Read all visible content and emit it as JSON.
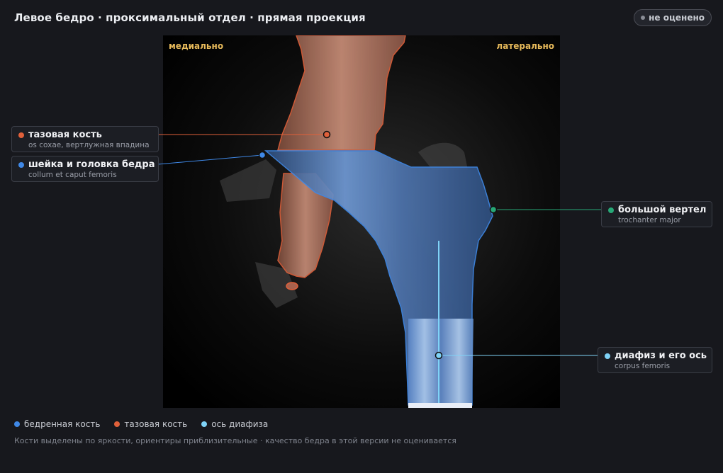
{
  "title": "Левое бедро · проксимальный отдел · прямая проекция",
  "status": {
    "label": "не оценено",
    "dot_color": "#8a8d96"
  },
  "viewer": {
    "orientation_left": "медиально",
    "orientation_right": "латерально"
  },
  "annotations": {
    "pelvis": {
      "title": "тазовая кость",
      "subtitle": "os coxae, вертлужная впадина",
      "color": "#e0603a"
    },
    "neck_head": {
      "title": "шейка и головка бедра",
      "subtitle": "collum et caput femoris",
      "color": "#3f88e6"
    },
    "greater_trochanter": {
      "title": "большой вертел",
      "subtitle": "trochanter major",
      "color": "#27a877"
    },
    "shaft": {
      "title": "диафиз и его ось",
      "subtitle": "corpus femoris",
      "color": "#7fd3f7"
    }
  },
  "legend": [
    {
      "label": "бедренная кость",
      "color": "#3f88e6"
    },
    {
      "label": "тазовая кость",
      "color": "#e0603a"
    },
    {
      "label": "ось диафиза",
      "color": "#7fd3f7"
    }
  ],
  "footnote": "Кости выделены по яркости, ориентиры приблизительные · качество бедра в этой версии не оценивается"
}
